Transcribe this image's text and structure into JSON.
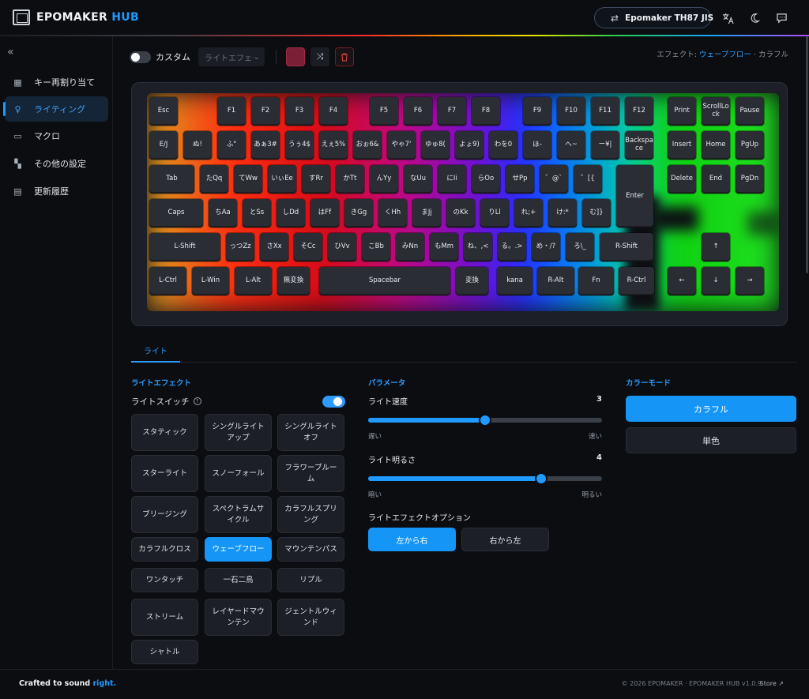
{
  "header": {
    "brand_main": "EPOMAKER",
    "brand_accent": "HUB",
    "device_name": "Epomaker TH87 JIS",
    "swap_icon": "⇄"
  },
  "sidebar": {
    "collapse_icon": "«",
    "items": [
      {
        "label": "キー再割り当て",
        "icon": "keyboard-icon",
        "glyph": "▦"
      },
      {
        "label": "ライティング",
        "icon": "bulb-icon",
        "glyph": "♀"
      },
      {
        "label": "マクロ",
        "icon": "macro-icon",
        "glyph": "▭"
      },
      {
        "label": "その他の設定",
        "icon": "grid-icon",
        "glyph": "▚"
      },
      {
        "label": "更新履歴",
        "icon": "doc-icon",
        "glyph": "▤"
      }
    ]
  },
  "toolbar": {
    "custom_label": "カスタム",
    "effect_placeholder": "ライトエフェクト",
    "color": "#7a1f35"
  },
  "effect_status": {
    "label": "エフェクト:",
    "effect": "ウェーブフロー",
    "sep": "·",
    "mode": "カラフル"
  },
  "keyboard_rows": [
    [
      "Esc",
      "F1",
      "F2",
      "F3",
      "F4",
      "F5",
      "F6",
      "F7",
      "F8",
      "F9",
      "F10",
      "F11",
      "F12",
      "Print",
      "ScrollLo\nck",
      "Pause"
    ],
    [
      "E/J",
      "ぬ!",
      "ふ\"",
      "あぁ3#",
      "うぅ4$",
      "えぇ5%",
      "おぉ6&",
      "やゃ7'",
      "ゆゅ8(",
      "よょ9)",
      "わを0",
      "ほ-",
      "へ~",
      "ー¥|",
      "Backspa\nce",
      "Insert",
      "Home",
      "PgUp"
    ],
    [
      "Tab",
      "たQq",
      "てWw",
      "いぃEe",
      "すRr",
      "かTt",
      "んYy",
      "なUu",
      "にIi",
      "らOo",
      "せPp",
      "゛@`",
      "゜[{",
      "Enter",
      "Delete",
      "End",
      "PgDn"
    ],
    [
      "Caps",
      "ちAa",
      "とSs",
      "しDd",
      "はFf",
      "きGg",
      "くHh",
      "まJj",
      "のKk",
      "りLl",
      "れ;+",
      "け:*",
      "む]}"
    ],
    [
      "L-Shift",
      "っつZz",
      "さXx",
      "そCc",
      "ひVv",
      "こBb",
      "みNn",
      "もMm",
      "ね、,<",
      "る。.>",
      "め・/?",
      "ろ\\_",
      "R-Shift",
      "↑"
    ],
    [
      "L-Ctrl",
      "L-Win",
      "L-Alt",
      "無変換",
      "Spacebar",
      "変換",
      "kana",
      "R-Alt",
      "Fn",
      "R-Ctrl",
      "←",
      "↓",
      "→"
    ]
  ],
  "tabs": {
    "light": "ライト"
  },
  "light_effect": {
    "title": "ライトエフェクト",
    "switch_label": "ライトスイッチ",
    "help": "?",
    "effects": [
      "スタティック",
      "シングルライトアップ",
      "シングルライトオフ",
      "スターライト",
      "スノーフォール",
      "フラワーブルーム",
      "ブリージング",
      "スペクトラムサイクル",
      "カラフルスプリング",
      "カラフルクロス",
      "ウェーブフロー",
      "マウンテンパス",
      "ワンタッチ",
      "一石二鳥",
      "リプル",
      "ストリーム",
      "レイヤードマウンテン",
      "ジェントルウィンド",
      "シャトル"
    ],
    "selected": "ウェーブフロー"
  },
  "params": {
    "title": "パラメータ",
    "speed": {
      "label": "ライト速度",
      "value": 3,
      "max": 6,
      "fraction": 0.5,
      "low": "遅い",
      "high": "速い"
    },
    "brightness": {
      "label": "ライト明るさ",
      "value": 4,
      "max": 5,
      "fraction": 0.74,
      "low": "暗い",
      "high": "明るい"
    },
    "option_title": "ライトエフェクトオプション",
    "direction": [
      "左から右",
      "右から左"
    ],
    "direction_selected": "左から右"
  },
  "color_mode": {
    "title": "カラーモード",
    "options": [
      "カラフル",
      "単色"
    ],
    "selected": "カラフル"
  },
  "footer": {
    "tagline": "Crafted to sound",
    "tagline_accent": "right.",
    "copyright": "© 2026 EPOMAKER · EPOMAKER HUB v1.0.9",
    "store": "Store ↗"
  }
}
